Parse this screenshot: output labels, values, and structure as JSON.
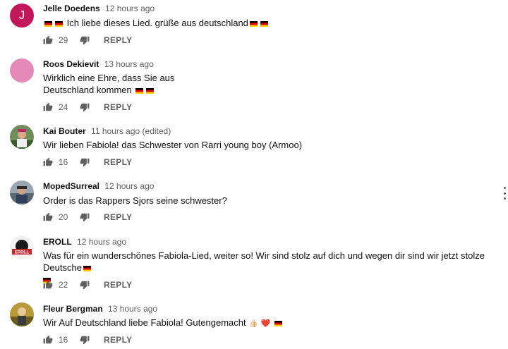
{
  "reply_label": "REPLY",
  "comments": [
    {
      "author": "Jelle Doedens",
      "time": "12 hours ago",
      "avatar_letter": "J",
      "text_line1": "Ich liebe dieses Lied. grüße aus deutschland",
      "likes": "29"
    },
    {
      "author": "Roos Dekievit",
      "time": "13 hours ago",
      "text_line1": "Wirklich eine Ehre, dass Sie aus",
      "text_line2": "Deutschland kommen",
      "likes": "24"
    },
    {
      "author": "Kai Bouter",
      "time": "11 hours ago (edited)",
      "text_line1": "Wir lieben Fabiola! das Schwester von Rarri young boy (Armoo)",
      "likes": "16"
    },
    {
      "author": "MopedSurreal",
      "time": "12 hours ago",
      "text_line1": "Order is das Rappers Sjors seine schwester?",
      "likes": "20"
    },
    {
      "author": "EROLL",
      "time": "12 hours ago",
      "avatar_text": "EROLL",
      "text_line1": "Was für ein wunderschönes Fabiola-Lied, weiter so! Wir sind stolz auf dich und wegen dir sind wir jetzt stolze Deutsche",
      "likes": "22"
    },
    {
      "author": "Fleur Bergman",
      "time": "13 hours ago",
      "text_line1": "Wir Auf Deutschland liebe Fabiola! Gutengemacht",
      "emoji_hand": "👍🏻",
      "emoji_heart": "❤️",
      "likes": "16"
    }
  ],
  "colors": {
    "avatar_j": "#c2185b",
    "avatar_pink": "#e58ab8",
    "meta": "#606060"
  },
  "icons": [
    "thumbs-up-icon",
    "thumbs-down-icon",
    "more-vertical-icon",
    "flag-de-icon"
  ]
}
